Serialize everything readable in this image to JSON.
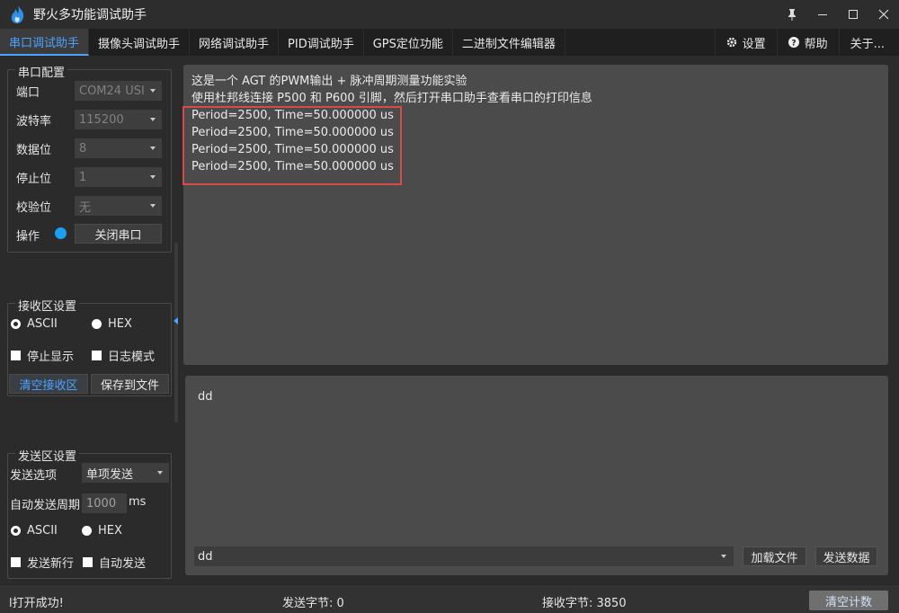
{
  "window": {
    "title": "野火多功能调试助手"
  },
  "tabs": [
    {
      "label": "串口调试助手",
      "active": true
    },
    {
      "label": "摄像头调试助手"
    },
    {
      "label": "网络调试助手"
    },
    {
      "label": "PID调试助手"
    },
    {
      "label": "GPS定位功能"
    },
    {
      "label": "二进制文件编辑器"
    }
  ],
  "tabs_right": {
    "settings": "设置",
    "help": "帮助",
    "about": "关于..."
  },
  "serial_config": {
    "title": "串口配置",
    "port_label": "端口",
    "port_value": "COM24 USI",
    "baud_label": "波特率",
    "baud_value": "115200",
    "databits_label": "数据位",
    "databits_value": "8",
    "stopbits_label": "停止位",
    "stopbits_value": "1",
    "parity_label": "校验位",
    "parity_value": "无",
    "op_label": "操作",
    "close_port": "关闭串口",
    "led_color": "#1aa0f0"
  },
  "recv_settings": {
    "title": "接收区设置",
    "ascii": "ASCII",
    "hex": "HEX",
    "stop_display": "停止显示",
    "log_mode": "日志模式",
    "clear_recv": "清空接收区",
    "save_file": "保存到文件"
  },
  "send_settings": {
    "title": "发送区设置",
    "option_label": "发送选项",
    "option_value": "单项发送",
    "auto_period_label": "自动发送周期",
    "auto_period_value": "1000",
    "unit": "ms",
    "ascii": "ASCII",
    "hex": "HEX",
    "newline": "发送新行",
    "auto_send": "自动发送"
  },
  "recv_area": {
    "lines": [
      "这是一个 AGT 的PWM输出 + 脉冲周期测量功能实验",
      "使用杜邦线连接 P500 和 P600 引脚，然后打开串口助手查看串口的打印信息",
      "Period=2500, Time=50.000000 us",
      "Period=2500, Time=50.000000 us",
      "Period=2500, Time=50.000000 us",
      "Period=2500, Time=50.000000 us"
    ],
    "highlight_color": "#d84a4a"
  },
  "send_area": {
    "text": "dd",
    "history_value": "dd",
    "load_file": "加载文件",
    "send_data": "发送数据"
  },
  "status": {
    "message": "l打开成功!",
    "sent": "发送字节: 0",
    "received": "接收字节: 3850",
    "clear_count": "清空计数"
  }
}
